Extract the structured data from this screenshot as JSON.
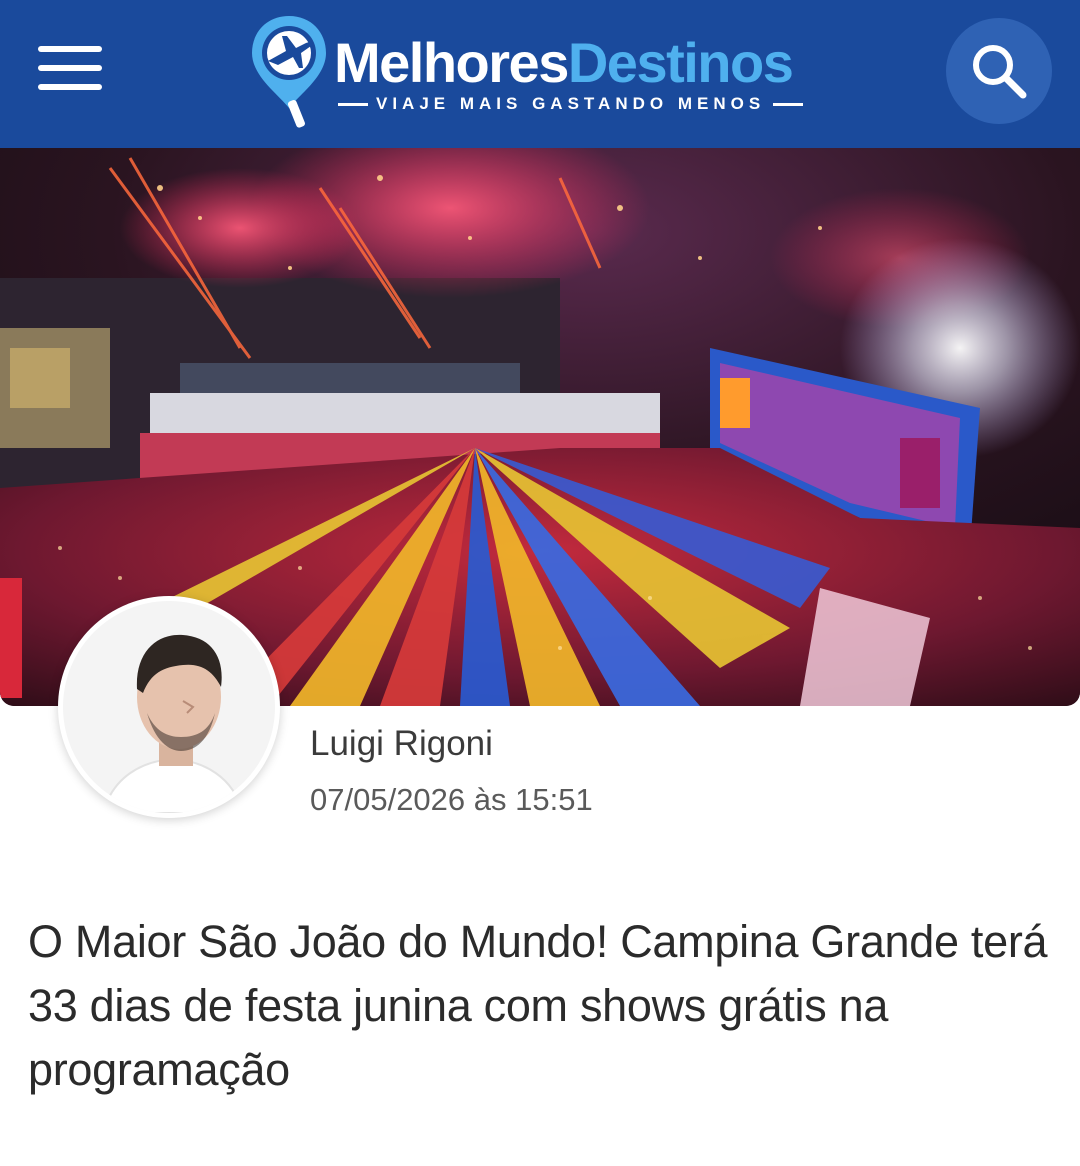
{
  "header": {
    "logo": {
      "name_part1": "Melhores",
      "name_part2": "Destinos",
      "tagline": "VIAJE MAIS GASTANDO MENOS"
    },
    "menu_icon": "hamburger-menu-icon",
    "search_icon": "search-icon",
    "colors": {
      "background": "#1a4a9c",
      "accent": "#4fb0ee",
      "search_bg": "#2f62b4"
    }
  },
  "hero": {
    "image": "aerial-festival-photo"
  },
  "article": {
    "author": "Luigi Rigoni",
    "date": "07/05/2026 às 15:51",
    "title": "O Maior São João do Mundo! Campina Grande terá 33 dias de festa junina com shows grátis na programação"
  }
}
